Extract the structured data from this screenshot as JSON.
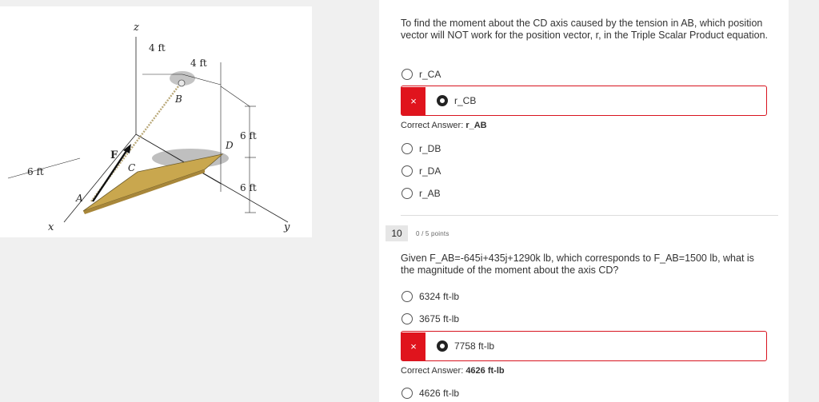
{
  "figure": {
    "labels": {
      "z": "z",
      "x": "x",
      "y": "y",
      "F": "F",
      "A": "A",
      "B": "B",
      "C": "C",
      "D": "D",
      "dim_4ft_left": "4 ft",
      "dim_4ft_right": "4 ft",
      "dim_6ft_upper": "6 ft",
      "dim_6ft_lower": "6 ft",
      "dim_6ft_left": "6 ft"
    },
    "colors": {
      "plate": "#c9a74e",
      "cable": "#b9a878",
      "force_arrow": "#111111"
    }
  },
  "question9": {
    "text": "To find the moment about the CD axis caused by the tension in AB, which position vector will NOT work for the position vector, r, in the Triple Scalar Product equation.",
    "choice_rca": "r_CA",
    "selected_choice": "r_CB",
    "correct_prefix": "Correct Answer:",
    "correct_value": "r_AB",
    "choice_rdb": "r_DB",
    "choice_rda": "r_DA",
    "choice_rab": "r_AB"
  },
  "question10": {
    "number": "10",
    "points": "0 / 5 points",
    "text": "Given F_AB=-645i+435j+1290k lb, which corresponds to F_AB=1500 lb, what is the magnitude of the moment about the axis CD?",
    "choice_1": "6324 ft-lb",
    "choice_2": "3675 ft-lb",
    "selected_choice": "7758 ft-lb",
    "correct_prefix": "Correct Answer:",
    "correct_value": "4626 ft-lb",
    "choice_4": "4626 ft-lb"
  },
  "icons": {
    "wrong_mark": "×"
  },
  "status_colors": {
    "wrong": "#e0141d"
  }
}
